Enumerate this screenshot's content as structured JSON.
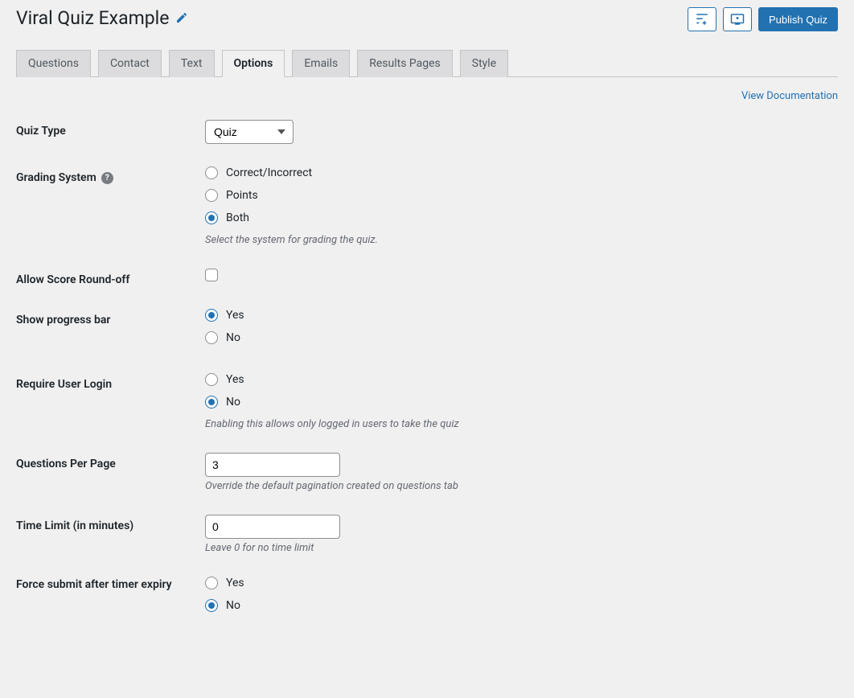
{
  "header": {
    "title": "Viral Quiz Example",
    "publish_button": "Publish Quiz"
  },
  "tabs": [
    {
      "label": "Questions",
      "active": false
    },
    {
      "label": "Contact",
      "active": false
    },
    {
      "label": "Text",
      "active": false
    },
    {
      "label": "Options",
      "active": true
    },
    {
      "label": "Emails",
      "active": false
    },
    {
      "label": "Results Pages",
      "active": false
    },
    {
      "label": "Style",
      "active": false
    }
  ],
  "doc_link": "View Documentation",
  "fields": {
    "quiz_type": {
      "label": "Quiz Type",
      "selected": "Quiz"
    },
    "grading_system": {
      "label": "Grading System",
      "options": [
        {
          "label": "Correct/Incorrect",
          "checked": false
        },
        {
          "label": "Points",
          "checked": false
        },
        {
          "label": "Both",
          "checked": true
        }
      ],
      "help": "Select the system for grading the quiz."
    },
    "allow_round_off": {
      "label": "Allow Score Round-off",
      "checked": false
    },
    "show_progress": {
      "label": "Show progress bar",
      "options": [
        {
          "label": "Yes",
          "checked": true
        },
        {
          "label": "No",
          "checked": false
        }
      ]
    },
    "require_login": {
      "label": "Require User Login",
      "options": [
        {
          "label": "Yes",
          "checked": false
        },
        {
          "label": "No",
          "checked": true
        }
      ],
      "help": "Enabling this allows only logged in users to take the quiz"
    },
    "questions_per_page": {
      "label": "Questions Per Page",
      "value": "3",
      "help": "Override the default pagination created on questions tab"
    },
    "time_limit": {
      "label": "Time Limit (in minutes)",
      "value": "0",
      "help": "Leave 0 for no time limit"
    },
    "force_submit": {
      "label": "Force submit after timer expiry",
      "options": [
        {
          "label": "Yes",
          "checked": false
        },
        {
          "label": "No",
          "checked": true
        }
      ]
    }
  }
}
